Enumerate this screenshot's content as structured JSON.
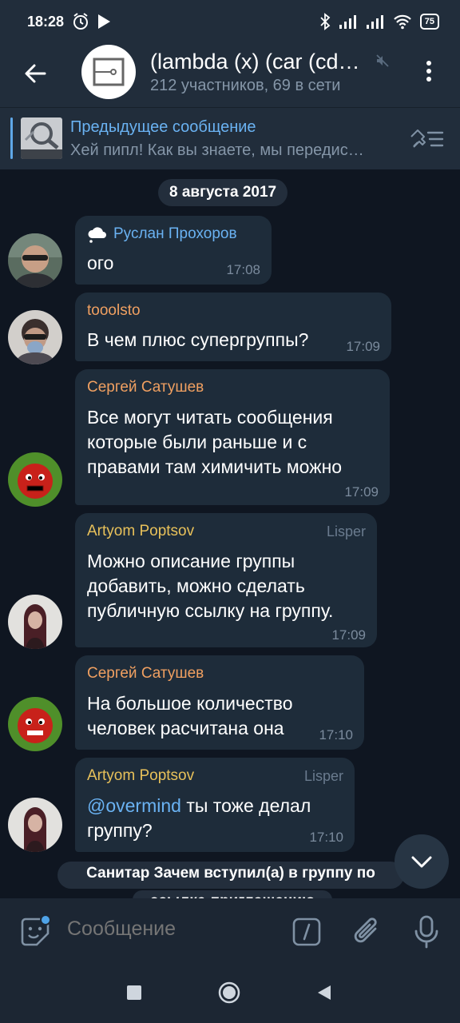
{
  "status_bar": {
    "time": "18:28",
    "battery": "75"
  },
  "header": {
    "title": "(lambda (x) (car (cd…",
    "subtitle": "212 участников, 69 в сети"
  },
  "pinned": {
    "title": "Предыдущее сообщение",
    "text": "Хей пипл! Как вы знаете, мы передис…"
  },
  "date_chip": "8 августа 2017",
  "messages": [
    {
      "sender": "Руслан Прохоров",
      "sender_color": "#6ab2f2",
      "lines": [
        "ого"
      ],
      "time": "17:08"
    },
    {
      "sender": "tooolsto",
      "sender_color": "#f0a061",
      "lines": [
        "В чем плюс супергруппы?"
      ],
      "time": "17:09"
    },
    {
      "sender": "Сергей Сатушев",
      "sender_color": "#f0a061",
      "lines": [
        "Все могут читать сообщения",
        "которые были раньше и с",
        "правами там химичить можно"
      ],
      "time": "17:09"
    },
    {
      "sender": "Artyom Poptsov",
      "sender_color": "#e8c15a",
      "rank": "Lisper",
      "lines": [
        "Можно описание группы",
        "добавить, можно сделать",
        "публичную ссылку на группу."
      ],
      "time": "17:09"
    },
    {
      "sender": "Сергей Сатушев",
      "sender_color": "#f0a061",
      "lines": [
        "На большое количество",
        "человек расчитана она"
      ],
      "time": "17:10"
    },
    {
      "sender": "Artyom Poptsov",
      "sender_color": "#e8c15a",
      "rank": "Lisper",
      "mention": "@overmind",
      "lines": [
        " ты тоже делал",
        "группу?"
      ],
      "time": "17:10"
    }
  ],
  "service": {
    "line1": "Санитар Зачем вступил(а) в группу по",
    "line2": "ссылке-приглашению"
  },
  "input": {
    "placeholder": "Сообщение"
  }
}
